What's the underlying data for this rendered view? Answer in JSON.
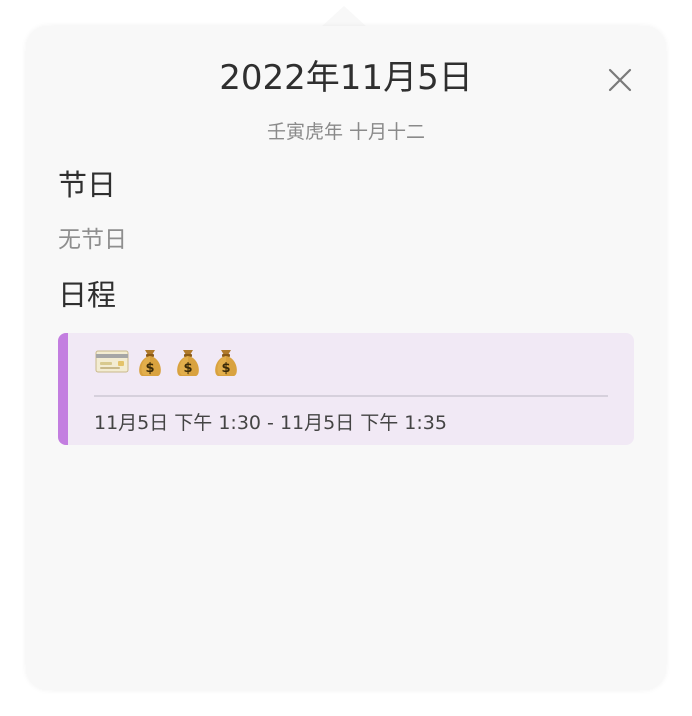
{
  "header": {
    "date_title": "2022年11月5日",
    "lunar_date": "壬寅虎年 十月十二"
  },
  "holidays": {
    "heading": "节日",
    "empty_text": "无节日"
  },
  "schedule": {
    "heading": "日程",
    "events": [
      {
        "title_icons": [
          "credit-card",
          "money-bag",
          "money-bag",
          "money-bag"
        ],
        "time_range": "11月5日 下午 1:30 - 11月5日 下午 1:35",
        "accent_color": "#c37ee0",
        "background_color": "#f1e9f5"
      }
    ]
  },
  "controls": {
    "close_icon": "close-icon"
  }
}
